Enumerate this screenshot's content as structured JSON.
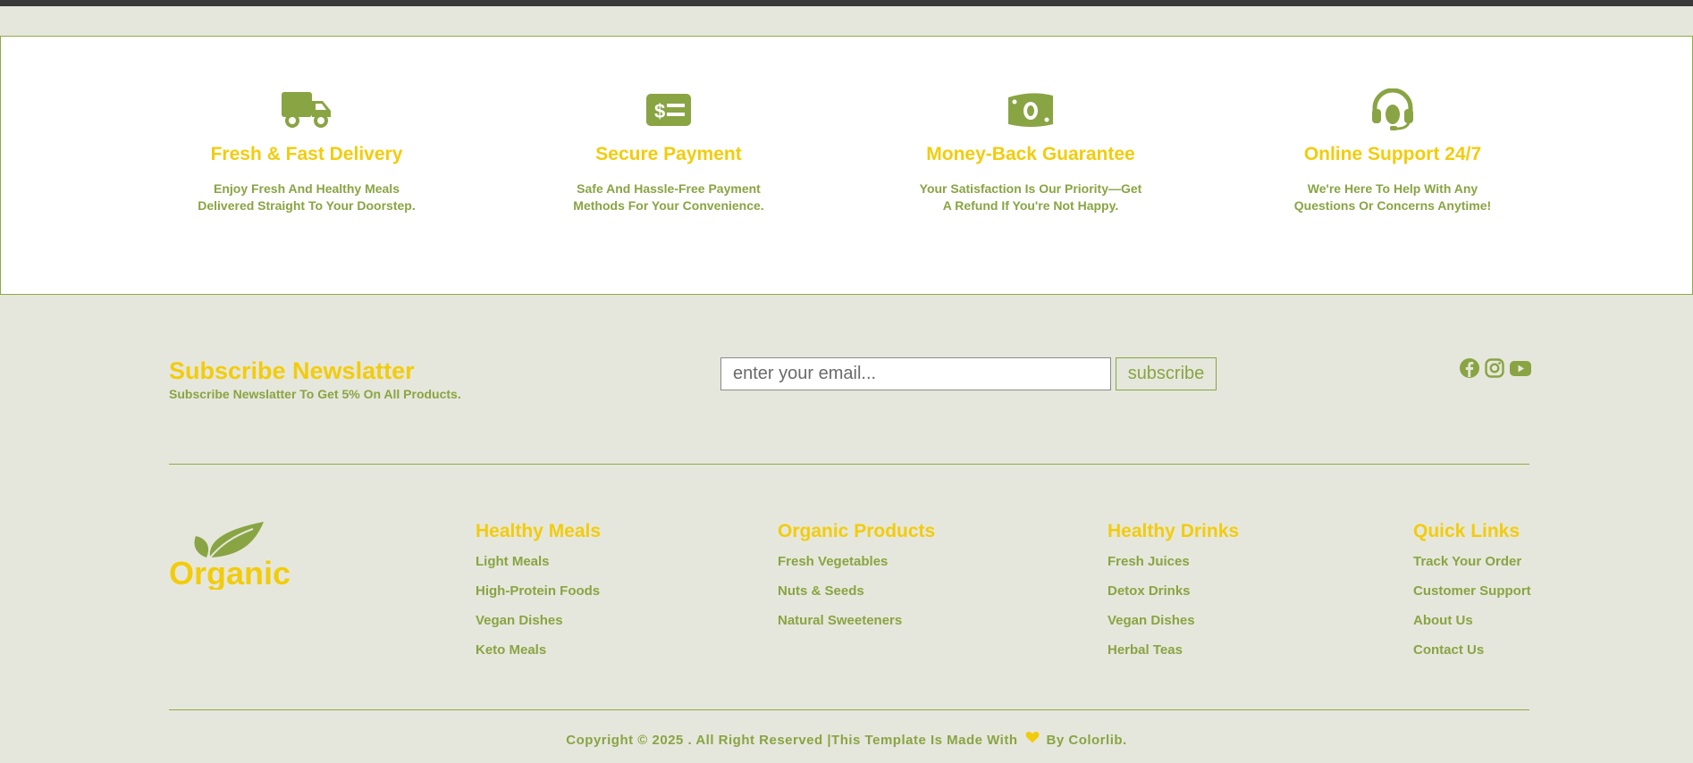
{
  "features": [
    {
      "icon": "truck-icon",
      "title": "Fresh & Fast Delivery",
      "line1": "Enjoy Fresh And Healthy Meals",
      "line2": "Delivered Straight To Your Doorstep."
    },
    {
      "icon": "payment-card-icon",
      "title": "Secure Payment",
      "line1": "Safe And Hassle-Free Payment",
      "line2": "Methods For Your Convenience."
    },
    {
      "icon": "money-bill-icon",
      "title": "Money-Back Guarantee",
      "line1": "Your Satisfaction Is Our Priority—Get",
      "line2": "A Refund If You're Not Happy."
    },
    {
      "icon": "headset-icon",
      "title": "Online Support 24/7",
      "line1": "We're Here To Help With Any",
      "line2": "Questions Or Concerns Anytime!"
    }
  ],
  "newsletter": {
    "title": "Subscribe Newslatter",
    "subtitle": "Subscribe Newslatter To Get 5% On All Products.",
    "placeholder": "enter your email...",
    "button": "subscribe"
  },
  "social": [
    "facebook-icon",
    "instagram-icon",
    "youtube-icon"
  ],
  "logo": {
    "text": "Organic"
  },
  "columns": [
    {
      "title": "Healthy Meals",
      "links": [
        "Light Meals",
        "High-Protein Foods",
        "Vegan Dishes",
        "Keto Meals"
      ]
    },
    {
      "title": "Organic Products",
      "links": [
        "Fresh Vegetables",
        "Nuts & Seeds",
        "Natural Sweeteners"
      ]
    },
    {
      "title": "Healthy Drinks",
      "links": [
        "Fresh Juices",
        "Detox Drinks",
        "Vegan Dishes",
        "Herbal Teas"
      ]
    },
    {
      "title": "Quick Links",
      "links": [
        "Track Your Order",
        "Customer Support",
        "About Us",
        "Contact Us"
      ]
    }
  ],
  "copyright": {
    "before": "Copyright © 2025 . All Right Reserved |This Template Is Made With",
    "after": "By Colorlib."
  },
  "colors": {
    "accent_yellow": "#f2cc0c",
    "accent_green": "#89a443",
    "footer_bg": "#e6e7dc"
  }
}
